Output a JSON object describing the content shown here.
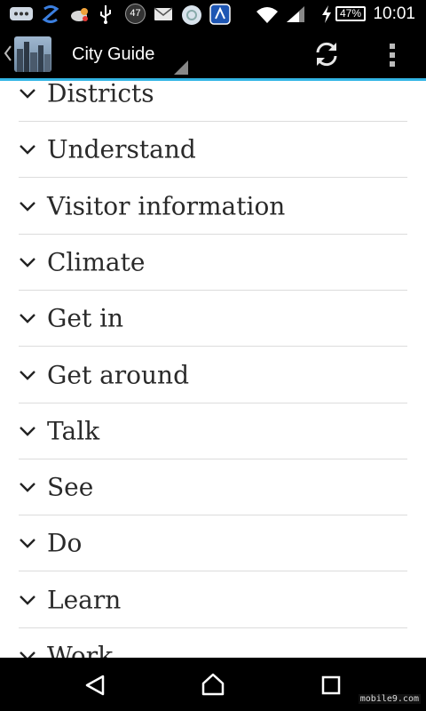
{
  "status_bar": {
    "notification_count": "47",
    "battery": "47%",
    "time": "10:01"
  },
  "action_bar": {
    "title": "City Guide",
    "accent_color": "#33b5e5"
  },
  "sections": [
    {
      "label": "Districts"
    },
    {
      "label": "Understand"
    },
    {
      "label": "Visitor information"
    },
    {
      "label": "Climate"
    },
    {
      "label": "Get in"
    },
    {
      "label": "Get around"
    },
    {
      "label": "Talk"
    },
    {
      "label": "See"
    },
    {
      "label": "Do"
    },
    {
      "label": "Learn"
    },
    {
      "label": "Work"
    }
  ],
  "watermark": "mobile9.com"
}
